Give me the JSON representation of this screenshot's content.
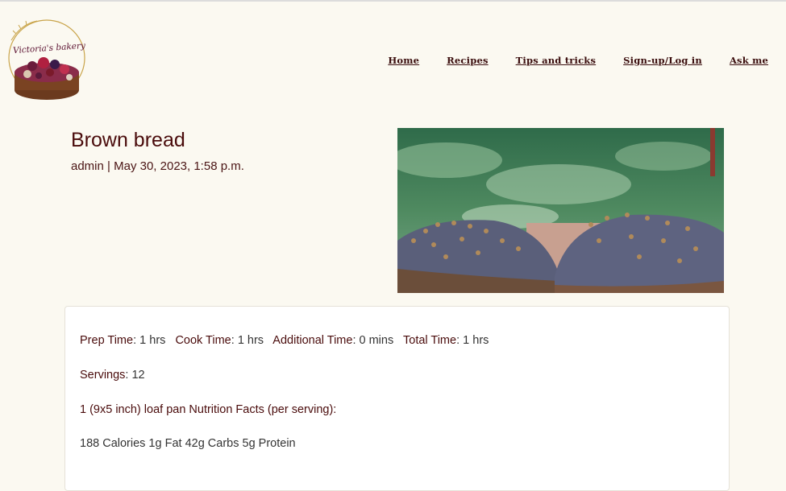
{
  "brand": {
    "logo_text": "Victoria's bakery"
  },
  "nav": {
    "home": "Home",
    "recipes": "Recipes",
    "tips": "Tips and tricks",
    "signup": "Sign-up/Log in",
    "ask": "Ask me"
  },
  "post": {
    "title": "Brown bread",
    "author": "admin",
    "separator": "|",
    "date": "May 30, 2023, 1:58 p.m."
  },
  "recipe": {
    "prep_label": "Prep Time",
    "prep_value": "1 hrs",
    "cook_label": "Cook Time",
    "cook_value": "1 hrs",
    "additional_label": "Additional Time",
    "additional_value": "0 mins",
    "total_label": "Total Time",
    "total_value": "1 hrs",
    "servings_label": "Servings",
    "servings_value": "12",
    "nutrition_heading": "1 (9x5 inch) loaf pan Nutrition Facts (per serving):",
    "nutrition_values": "188 Calories 1g Fat 42g Carbs 5g Protein"
  },
  "colors": {
    "accent": "#4a0c0c",
    "background": "#fbf9f1"
  }
}
